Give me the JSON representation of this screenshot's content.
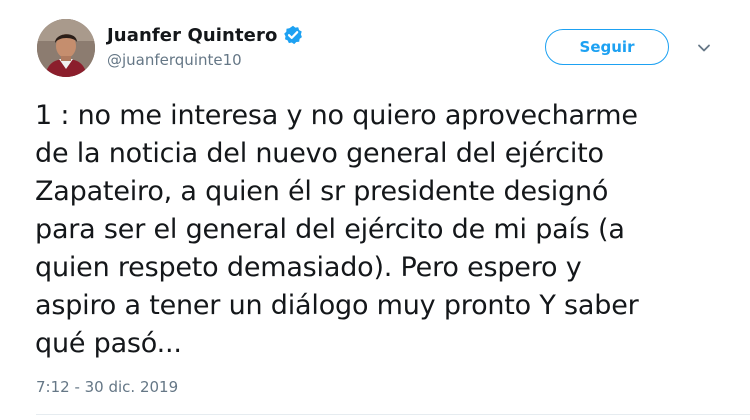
{
  "colors": {
    "brand": "#1da1f2",
    "text": "#14171a",
    "secondary_text": "#657786",
    "divider": "#e6ecf0"
  },
  "author": {
    "display_name": "Juanfer Quintero",
    "handle": "@juanferquinte10",
    "verified_icon": "verified-badge-icon",
    "avatar": "profile-photo"
  },
  "actions": {
    "follow_label": "Seguir",
    "more_icon": "chevron-down-icon"
  },
  "tweet": {
    "lines": [
      "1 : no me interesa y no quiero aprovecharme",
      "de la noticia del nuevo general del ejército",
      "Zapateiro, a quien él sr presidente designó",
      "para ser el general del ejército de mi país (a",
      "quien respeto demasiado). Pero espero y",
      "aspiro a tener un diálogo muy pronto Y saber",
      "qué pasó..."
    ],
    "timestamp": "7:12 - 30 dic. 2019"
  }
}
